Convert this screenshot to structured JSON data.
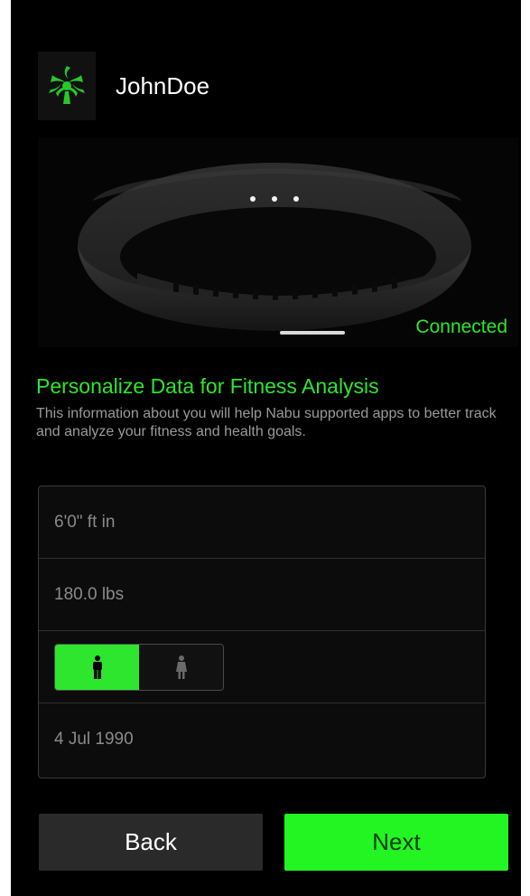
{
  "header": {
    "username": "JohnDoe",
    "logo_icon": "razer-snake-logo-icon"
  },
  "device": {
    "status": "Connected",
    "image_icon": "fitness-band-icon"
  },
  "personalize": {
    "title": "Personalize Data for Fitness Analysis",
    "description": "This information about you will help Nabu supported apps to better track and analyze your fitness and health goals."
  },
  "form": {
    "height": "6'0\" ft in",
    "weight": "180.0 lbs",
    "gender": {
      "selected": "male",
      "options": [
        "male-icon",
        "female-icon"
      ]
    },
    "birthdate": "4 Jul 1990"
  },
  "buttons": {
    "back": "Back",
    "next": "Next"
  },
  "colors": {
    "accent": "#2ee62e",
    "background": "#000000",
    "next_button": "#22f522",
    "back_button": "#2a2a2a"
  }
}
